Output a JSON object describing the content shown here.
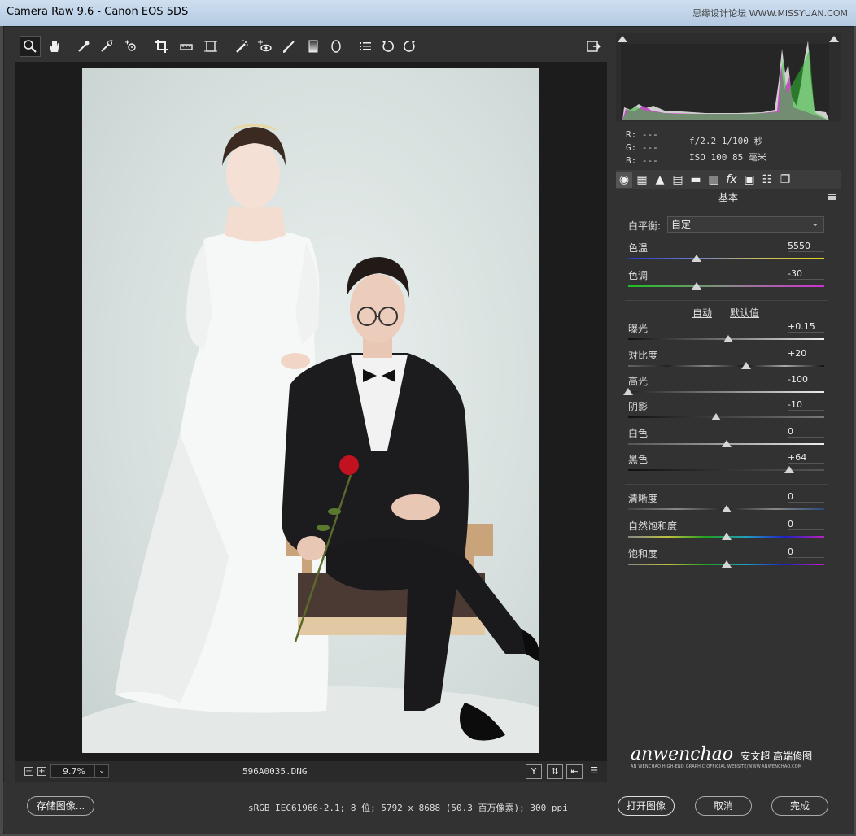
{
  "window": {
    "title": "Camera Raw 9.6 -  Canon EOS 5DS",
    "watermark": "思缘设计论坛  WWW.MISSYUAN.COM"
  },
  "toolbar": {
    "tools": [
      "zoom-tool",
      "hand-tool",
      "white-balance-tool",
      "color-sampler-tool",
      "targeted-adjustment-tool",
      "crop-tool",
      "straighten-tool",
      "transform-tool",
      "spot-removal-tool",
      "red-eye-tool",
      "adjustment-brush-tool",
      "graduated-filter-tool",
      "radial-filter-tool",
      "preferences-tool",
      "rotate-left-tool",
      "rotate-right-tool"
    ],
    "fullscreen_icon": "fullscreen-icon"
  },
  "status": {
    "zoom": "9.7%",
    "filename": "596A0035.DNG",
    "right_buttons": [
      "Y"
    ]
  },
  "histogram": {
    "info": {
      "r": "R:  ---",
      "g": "G:  ---",
      "b": "B:  ---",
      "aperture_shutter": "f/2.2   1/100 秒",
      "iso_focal": "ISO 100   85 毫米"
    }
  },
  "panel": {
    "title": "基本",
    "white_balance": {
      "label": "白平衡:",
      "value": "自定"
    },
    "auto": "自动",
    "default": "默认值",
    "sliders": [
      {
        "label": "色温",
        "value": "5550",
        "pos": 0.35
      },
      {
        "label": "色调",
        "value": "-30",
        "pos": 0.35
      },
      {
        "label": "曝光",
        "value": "+0.15",
        "pos": 0.51
      },
      {
        "label": "对比度",
        "value": "+20",
        "pos": 0.6
      },
      {
        "label": "高光",
        "value": "-100",
        "pos": 0.0
      },
      {
        "label": "阴影",
        "value": "-10",
        "pos": 0.45
      },
      {
        "label": "白色",
        "value": "0",
        "pos": 0.5
      },
      {
        "label": "黑色",
        "value": "+64",
        "pos": 0.82
      },
      {
        "label": "清晰度",
        "value": "0",
        "pos": 0.5
      },
      {
        "label": "自然饱和度",
        "value": "0",
        "pos": 0.5
      },
      {
        "label": "饱和度",
        "value": "0",
        "pos": 0.5
      }
    ]
  },
  "bottom": {
    "save": "存储图像...",
    "workflow": "sRGB IEC61966-2.1; 8 位; 5792 x 8688 (50.3 百万像素); 300 ppi",
    "open": "打开图像",
    "cancel": "取消",
    "done": "完成"
  },
  "brand": {
    "name": "anwenchao",
    "cn": "安文超 高端修图",
    "tagline": "AN WENCHAO HIGH-END GRAPHIC OFFICIAL WEBSITE/WWW.ANWENCHAO.COM"
  }
}
